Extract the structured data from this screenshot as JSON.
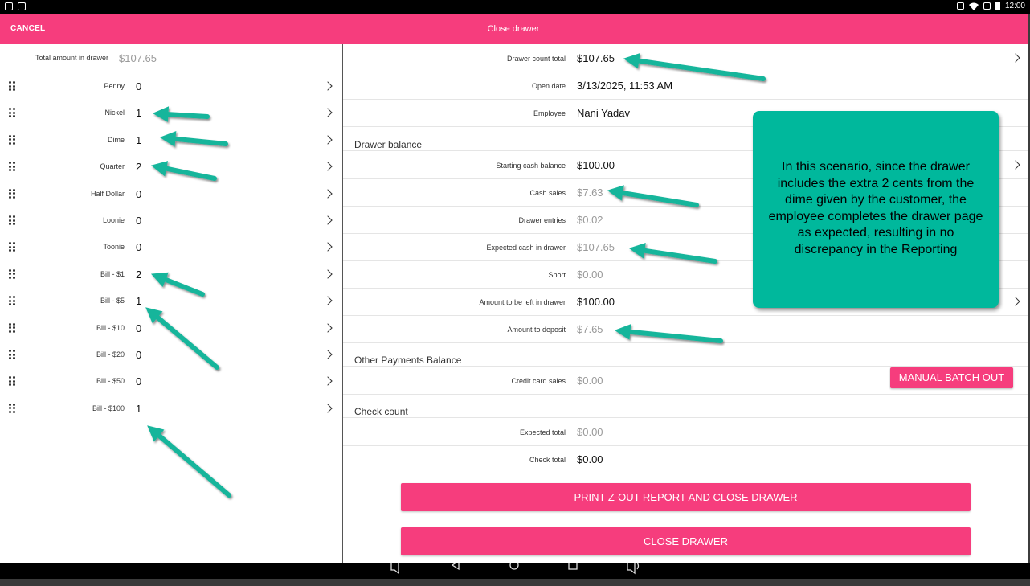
{
  "status_bar": {
    "time": "12:00",
    "left_icons": [
      "app-notification-icon",
      "check-notification-icon"
    ],
    "right_icons": [
      "cast-icon",
      "wifi-icon",
      "no-sim-icon",
      "battery-icon"
    ]
  },
  "header": {
    "cancel_label": "CANCEL",
    "title": "Close drawer",
    "background_color": "#f63d7d"
  },
  "left_pane": {
    "total_label": "Total amount in drawer",
    "total_value": "$107.65",
    "denominations": [
      {
        "label": "Penny",
        "count": "0"
      },
      {
        "label": "Nickel",
        "count": "1"
      },
      {
        "label": "Dime",
        "count": "1"
      },
      {
        "label": "Quarter",
        "count": "2"
      },
      {
        "label": "Half Dollar",
        "count": "0"
      },
      {
        "label": "Loonie",
        "count": "0"
      },
      {
        "label": "Toonie",
        "count": "0"
      },
      {
        "label": "Bill - $1",
        "count": "2"
      },
      {
        "label": "Bill - $5",
        "count": "1"
      },
      {
        "label": "Bill - $10",
        "count": "0"
      },
      {
        "label": "Bill - $20",
        "count": "0"
      },
      {
        "label": "Bill - $50",
        "count": "0"
      },
      {
        "label": "Bill - $100",
        "count": "1"
      }
    ]
  },
  "right_pane": {
    "drawer_count_total": {
      "label": "Drawer count total",
      "value": "$107.65"
    },
    "open_date": {
      "label": "Open date",
      "value": "3/13/2025, 11:53 AM"
    },
    "employee": {
      "label": "Employee",
      "value": "Nani Yadav"
    },
    "drawer_balance_heading": "Drawer balance",
    "starting_cash_balance": {
      "label": "Starting cash balance",
      "value": "$100.00"
    },
    "cash_sales": {
      "label": "Cash sales",
      "value": "$7.63"
    },
    "drawer_entries": {
      "label": "Drawer entries",
      "value": "$0.02"
    },
    "expected_cash": {
      "label": "Expected cash in drawer",
      "value": "$107.65"
    },
    "short": {
      "label": "Short",
      "value": "$0.00"
    },
    "amount_left": {
      "label": "Amount to be left in drawer",
      "value": "$100.00"
    },
    "amount_deposit": {
      "label": "Amount to deposit",
      "value": "$7.65"
    },
    "other_payments_heading": "Other Payments Balance",
    "credit_card_sales": {
      "label": "Credit card sales",
      "value": "$0.00"
    },
    "manual_batch_out_label": "MANUAL BATCH OUT",
    "check_count_heading": "Check count",
    "expected_total": {
      "label": "Expected total",
      "value": "$0.00"
    },
    "check_total": {
      "label": "Check total",
      "value": "$0.00"
    },
    "print_close_label": "PRINT Z-OUT REPORT AND CLOSE DRAWER",
    "close_label": "CLOSE DRAWER"
  },
  "callout": {
    "text": "In this scenario, since the drawer includes the extra 2 cents from the dime given by the customer, the employee completes the drawer page as expected, resulting in no discrepancy in the Reporting",
    "color": "#00b89c"
  },
  "nav_bar": {
    "icons": [
      "volume-down-icon",
      "back-icon",
      "home-icon",
      "recents-icon",
      "volume-up-icon"
    ]
  }
}
